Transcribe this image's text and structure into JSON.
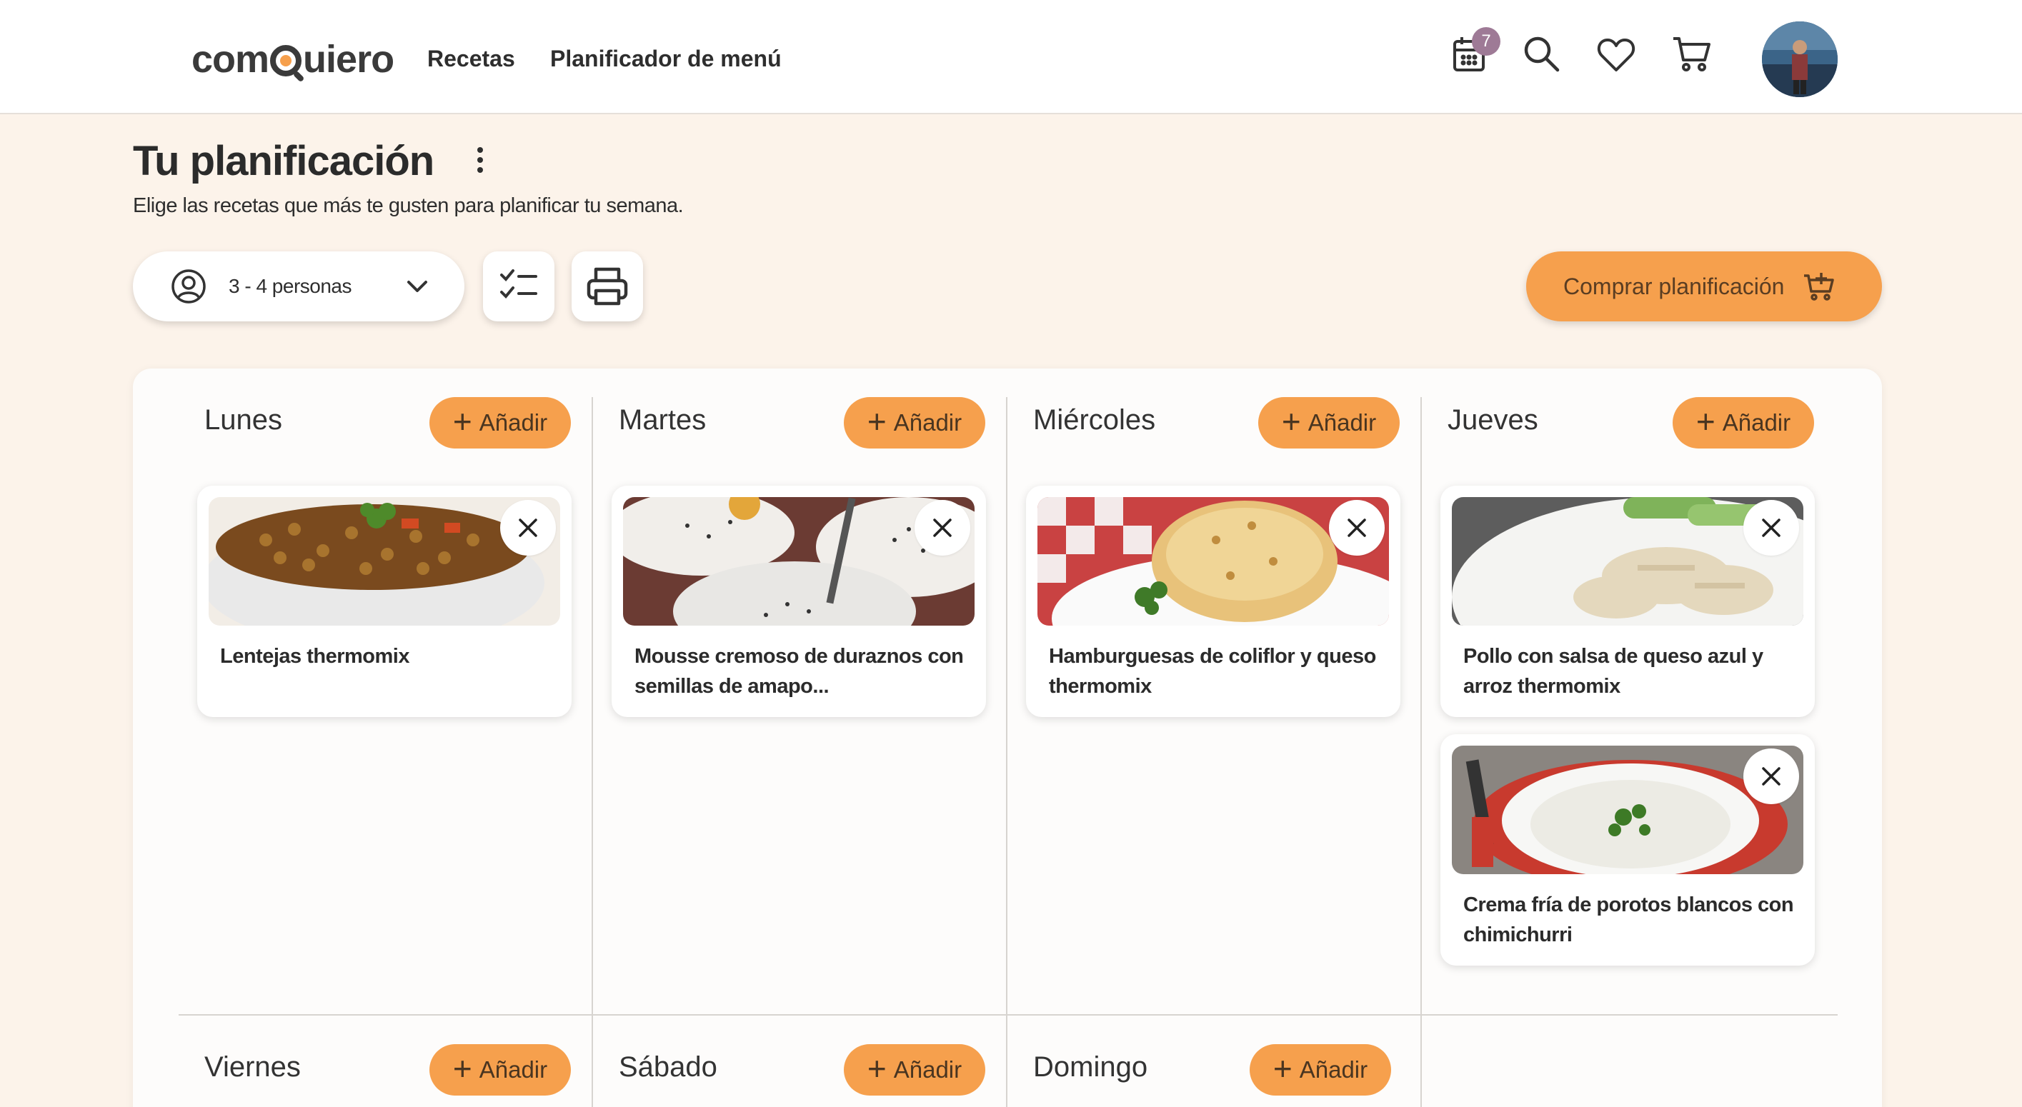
{
  "header": {
    "logo": {
      "part1": "com",
      "part2": "uiero"
    },
    "nav": {
      "recipes": "Recetas",
      "planner": "Planificador de menú"
    },
    "calendar_badge": "7",
    "icons": [
      "calendar-icon",
      "search-icon",
      "heart-icon",
      "cart-icon"
    ]
  },
  "page": {
    "title": "Tu planificación",
    "subtitle": "Elige las recetas que más te gusten para planificar tu semana."
  },
  "controls": {
    "people_value": "3 - 4 personas",
    "buy_label": "Comprar planificación"
  },
  "planner": {
    "add_label": "Añadir",
    "days": [
      {
        "name": "Lunes",
        "recipes": [
          {
            "title": "Lentejas thermomix"
          }
        ]
      },
      {
        "name": "Martes",
        "recipes": [
          {
            "title": "Mousse cremoso de duraznos con semillas de amapo..."
          }
        ]
      },
      {
        "name": "Miércoles",
        "recipes": [
          {
            "title": "Hamburguesas de coliflor y queso thermomix"
          }
        ]
      },
      {
        "name": "Jueves",
        "recipes": [
          {
            "title": "Pollo con salsa de queso azul y arroz thermomix"
          },
          {
            "title": "Crema fría de porotos blancos con chimichurri"
          }
        ]
      },
      {
        "name": "Viernes",
        "recipes": []
      },
      {
        "name": "Sábado",
        "recipes": []
      },
      {
        "name": "Domingo",
        "recipes": []
      }
    ]
  },
  "colors": {
    "accent": "#f6a04d",
    "background": "#fcf3ea",
    "badge": "#9e7a96"
  }
}
